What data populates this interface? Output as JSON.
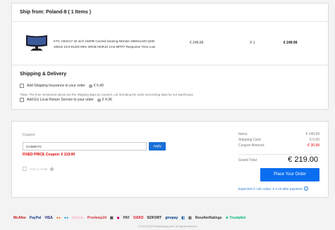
{
  "shipping": {
    "header": "Ship from: Poland-8 ( 1 Items )",
    "item": {
      "name_line1": "KTC H32S17 32 inch 1500R Curved Gaming Monitor 2560x1440 QHD",
      "name_line2": "165Hz 16:9 ELED 99% sRGB HDR10 1ms MPRT Response Time Low",
      "price": "€ 249.99",
      "qty": "X 1",
      "total": "€ 249.99"
    },
    "delivery_title": "Shipping & Delivery",
    "insurance_label": "Add Shipping Insurance to your order",
    "insurance_price": "€ 5.49",
    "note": "*Note: The time mentioned above are the shipping days by couriers, not including the order processing days by our warehouse.",
    "return_label": "Add EU Local Return Service to your order",
    "return_price": "€ 4.39"
  },
  "order": {
    "coupon_label": "Coupon",
    "coupon_value": "GAM6KTC",
    "apply_label": "Apply",
    "fixed_price": "FIXED PRICE Coupon: € 219.00",
    "credit_label": "Use G credit",
    "summary": {
      "items_label": "Items:",
      "items_value": "€ 249.99",
      "shipping_label": "Shipping Cost:",
      "shipping_value": "€ 0.00",
      "coupon_label": "Coupon Amount:",
      "coupon_value": "-€ 30.99"
    },
    "grand_total_label": "Grand Total:",
    "grand_total_value": "€ 219.00",
    "place_order_label": "Place Your Order",
    "expected_points": "Expected G coin value: € 2.19 after payment"
  },
  "footer": {
    "logos": [
      {
        "name": "mcafee-logo",
        "text": "McAfee",
        "color": "#c01818"
      },
      {
        "name": "paypal-logo",
        "text": "PayPal",
        "color": "#1b3f8f"
      },
      {
        "name": "visa-logo",
        "text": "VISA",
        "color": "#1a1f71"
      },
      {
        "name": "mastercard-logo",
        "text": "●●",
        "color": "#eb6b14"
      },
      {
        "name": "maestro-logo",
        "text": "●●",
        "color": "#0099df"
      },
      {
        "name": "klarna-logo",
        "text": "Klarna.",
        "color": "#ffb3c7"
      },
      {
        "name": "przelewy-logo",
        "text": "Przelewy24",
        "color": "#d13239"
      },
      {
        "name": "bank-logo",
        "text": "▦",
        "color": "#444"
      },
      {
        "name": "ideal-logo",
        "text": "◆",
        "color": "#cc0066"
      },
      {
        "name": "pay-logo",
        "text": "PAY",
        "color": "#333"
      },
      {
        "name": "oxxo-logo",
        "text": "OXXO",
        "color": "#e30613"
      },
      {
        "name": "sofort-logo",
        "text": "SOFORT",
        "color": "#222"
      },
      {
        "name": "giropay-logo",
        "text": "giropay",
        "color": "#003a7d"
      },
      {
        "name": "bancontact-logo",
        "text": "◧",
        "color": "#005498"
      },
      {
        "name": "boleto-logo",
        "text": "▥",
        "color": "#444"
      },
      {
        "name": "resellerratings-logo",
        "text": "ResellerRatings",
        "color": "#333"
      },
      {
        "name": "trustpilot-logo",
        "text": "★ Trustpilot",
        "color": "#00b67a"
      }
    ],
    "copyright": "© 2012-2023 Geekbuying.com. All rights reserved"
  },
  "colors": {
    "accent": "#0b6ef0",
    "price_red": "#e00000"
  }
}
